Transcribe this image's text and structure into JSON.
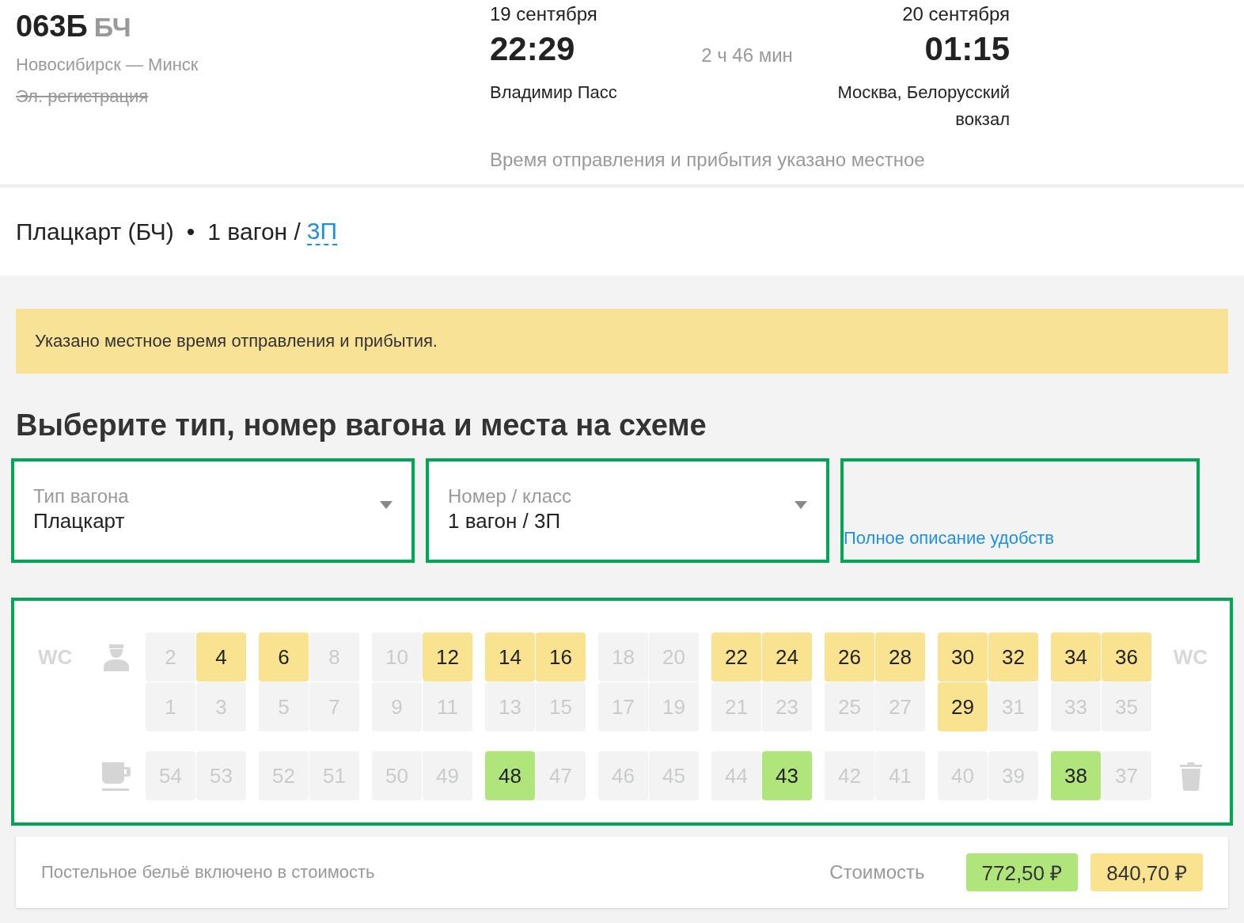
{
  "train": {
    "number": "063Б",
    "operator": "БЧ",
    "route": "Новосибирск — Минск",
    "e_registration": {
      "label": "Эл. регистрация",
      "available": false
    }
  },
  "departure": {
    "date": "19 сентября",
    "time": "22:29",
    "station": "Владимир Пасс"
  },
  "duration": "2 ч 46 мин",
  "arrival": {
    "date": "20 сентября",
    "time": "01:15",
    "station": "Москва, Белорусский вокзал"
  },
  "time_note": "Время отправления и прибытия указано местное",
  "car_summary": {
    "type": "Плацкарт (БЧ)",
    "separator": "•",
    "car": "1 вагон /",
    "class_link": "3П"
  },
  "notice": "Указано местное время отправления и прибытия.",
  "heading": "Выберите тип, номер вагона и места на схеме",
  "selects": [
    {
      "label": "Тип вагона",
      "value": "Плацкарт"
    },
    {
      "label": "Номер / класс",
      "value": "1 вагон / 3П"
    }
  ],
  "amenities_link": "Полное описание удобств",
  "seat_map": {
    "wc_left": "WC",
    "wc_right": "WC",
    "compartments": [
      {
        "top": [
          {
            "number": "2",
            "available": false
          },
          {
            "number": "4",
            "available": true,
            "color": "#fae390"
          }
        ],
        "bottom": [
          {
            "number": "1",
            "available": false
          },
          {
            "number": "3",
            "available": false
          }
        ],
        "side": [
          {
            "number": "54",
            "available": false
          },
          {
            "number": "53",
            "available": false
          }
        ]
      },
      {
        "top": [
          {
            "number": "6",
            "available": true,
            "color": "#fae390"
          },
          {
            "number": "8",
            "available": false
          }
        ],
        "bottom": [
          {
            "number": "5",
            "available": false
          },
          {
            "number": "7",
            "available": false
          }
        ],
        "side": [
          {
            "number": "52",
            "available": false
          },
          {
            "number": "51",
            "available": false
          }
        ]
      },
      {
        "top": [
          {
            "number": "10",
            "available": false
          },
          {
            "number": "12",
            "available": true,
            "color": "#fae390"
          }
        ],
        "bottom": [
          {
            "number": "9",
            "available": false
          },
          {
            "number": "11",
            "available": false
          }
        ],
        "side": [
          {
            "number": "50",
            "available": false
          },
          {
            "number": "49",
            "available": false
          }
        ]
      },
      {
        "top": [
          {
            "number": "14",
            "available": true,
            "color": "#fae390"
          },
          {
            "number": "16",
            "available": true,
            "color": "#fae390"
          }
        ],
        "bottom": [
          {
            "number": "13",
            "available": false
          },
          {
            "number": "15",
            "available": false
          }
        ],
        "side": [
          {
            "number": "48",
            "available": true,
            "color": "#b0e57c"
          },
          {
            "number": "47",
            "available": false
          }
        ]
      },
      {
        "top": [
          {
            "number": "18",
            "available": false
          },
          {
            "number": "20",
            "available": false
          }
        ],
        "bottom": [
          {
            "number": "17",
            "available": false
          },
          {
            "number": "19",
            "available": false
          }
        ],
        "side": [
          {
            "number": "46",
            "available": false
          },
          {
            "number": "45",
            "available": false
          }
        ]
      },
      {
        "top": [
          {
            "number": "22",
            "available": true,
            "color": "#fae390"
          },
          {
            "number": "24",
            "available": true,
            "color": "#fae390"
          }
        ],
        "bottom": [
          {
            "number": "21",
            "available": false
          },
          {
            "number": "23",
            "available": false
          }
        ],
        "side": [
          {
            "number": "44",
            "available": false
          },
          {
            "number": "43",
            "available": true,
            "color": "#b0e57c"
          }
        ]
      },
      {
        "top": [
          {
            "number": "26",
            "available": true,
            "color": "#fae390"
          },
          {
            "number": "28",
            "available": true,
            "color": "#fae390"
          }
        ],
        "bottom": [
          {
            "number": "25",
            "available": false
          },
          {
            "number": "27",
            "available": false
          }
        ],
        "side": [
          {
            "number": "42",
            "available": false
          },
          {
            "number": "41",
            "available": false
          }
        ]
      },
      {
        "top": [
          {
            "number": "30",
            "available": true,
            "color": "#fae390"
          },
          {
            "number": "32",
            "available": true,
            "color": "#fae390"
          }
        ],
        "bottom": [
          {
            "number": "29",
            "available": true,
            "color": "#fae390"
          },
          {
            "number": "31",
            "available": false
          }
        ],
        "side": [
          {
            "number": "40",
            "available": false
          },
          {
            "number": "39",
            "available": false
          }
        ]
      },
      {
        "top": [
          {
            "number": "34",
            "available": true,
            "color": "#fae390"
          },
          {
            "number": "36",
            "available": true,
            "color": "#fae390"
          }
        ],
        "bottom": [
          {
            "number": "33",
            "available": false
          },
          {
            "number": "35",
            "available": false
          }
        ],
        "side": [
          {
            "number": "38",
            "available": true,
            "color": "#b0e57c"
          },
          {
            "number": "37",
            "available": false
          }
        ]
      }
    ]
  },
  "footer": {
    "bedding_note": "Постельное бельё включено в стоимость",
    "cost_label": "Стоимость",
    "prices": [
      {
        "amount": "772,50 ₽",
        "color": "#b0e57c"
      },
      {
        "amount": "840,70 ₽",
        "color": "#fae390"
      }
    ]
  }
}
